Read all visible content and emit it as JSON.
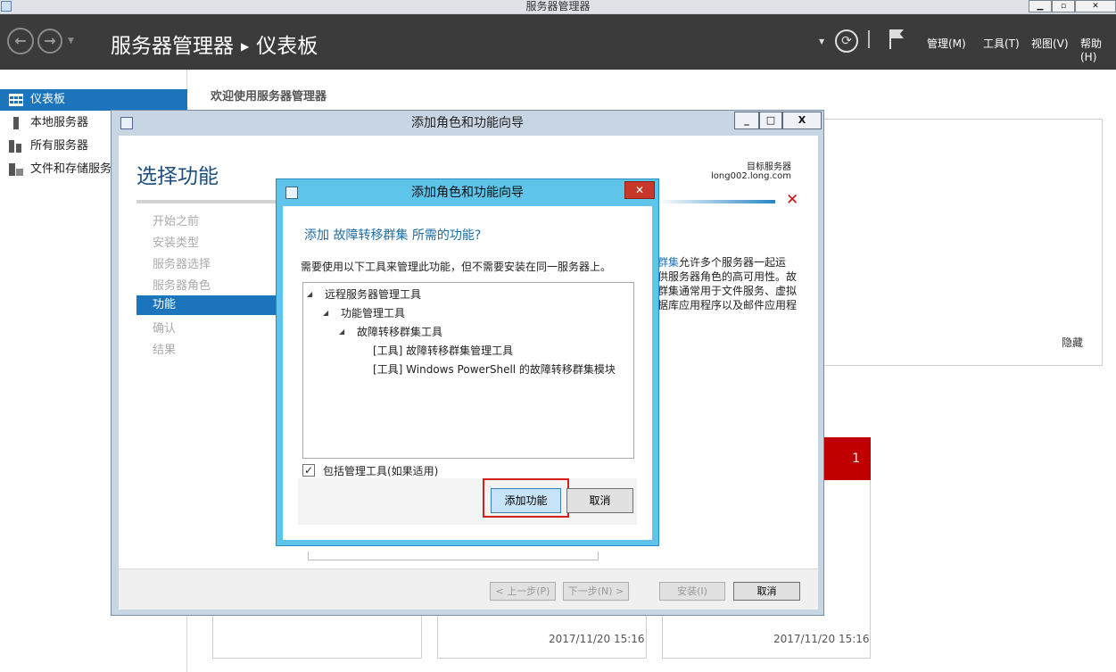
{
  "window": {
    "title": "服务器管理器",
    "controls": [
      "▁",
      "▫",
      "✕"
    ]
  },
  "header": {
    "breadcrumb_app": "服务器管理器",
    "breadcrumb_page": "仪表板",
    "refresh_icon": "⟳",
    "menu": [
      "管理(M)",
      "工具(T)",
      "视图(V)",
      "帮助(H)"
    ]
  },
  "sidebar": {
    "items": [
      {
        "label": "仪表板",
        "icon": "dashboard-icon",
        "active": true
      },
      {
        "label": "本地服务器",
        "icon": "local-server-icon",
        "active": false
      },
      {
        "label": "所有服务器",
        "icon": "all-servers-icon",
        "active": false
      },
      {
        "label": "文件和存储服务",
        "icon": "file-storage-icon",
        "active": false
      }
    ]
  },
  "main": {
    "welcome": "欢迎使用服务器管理器",
    "hide": "隐藏",
    "tile_count": "1",
    "timestamps": [
      "2017/11/20 15:16",
      "2017/11/20 15:16"
    ]
  },
  "wizard": {
    "title": "添加角色和功能向导",
    "heading": "选择功能",
    "target_label": "目标服务器",
    "target_value": "long002.long.com",
    "steps": [
      "开始之前",
      "安装类型",
      "服务器选择",
      "服务器角色",
      "功能",
      "确认",
      "结果"
    ],
    "active_step": "功能",
    "description": {
      "highlight": "群集",
      "line1": "允许多个服务器一起运",
      "line2": "供服务器角色的高可用性。故",
      "line3": "群集通常用于文件服务、虚拟",
      "line4": "据库应用程序以及邮件应用程"
    },
    "buttons": {
      "prev": "< 上一步(P)",
      "next": "下一步(N) >",
      "install": "安装(I)",
      "cancel": "取消"
    }
  },
  "dialog": {
    "title": "添加角色和功能向导",
    "close": "✕",
    "question": "添加 故障转移群集 所需的功能?",
    "note": "需要使用以下工具来管理此功能，但不需要安装在同一服务器上。",
    "tree": [
      "远程服务器管理工具",
      "功能管理工具",
      "故障转移群集工具",
      "[工具] 故障转移群集管理工具",
      "[工具] Windows PowerShell 的故障转移群集模块"
    ],
    "checkbox_label": "包括管理工具(如果适用)",
    "checkbox_checked": "✓",
    "add_button": "添加功能",
    "cancel_button": "取消"
  }
}
